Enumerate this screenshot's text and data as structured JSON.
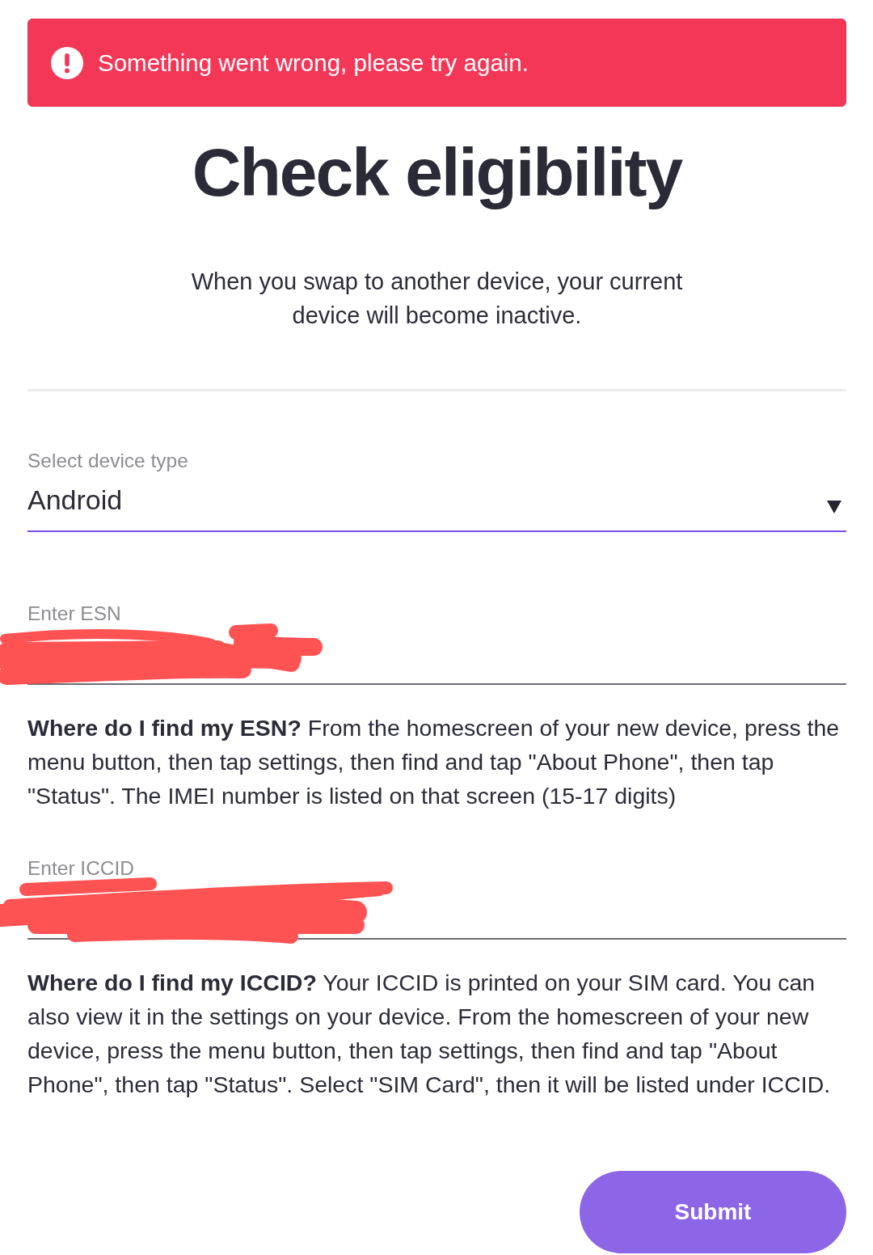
{
  "alert": {
    "kind": "error",
    "message": "Something went wrong, please try again."
  },
  "title": "Check eligibility",
  "subtitle": "When you swap to another device, your current device will become inactive.",
  "form": {
    "device_select": {
      "label": "Select device type",
      "value": "Android",
      "focused": true
    },
    "fields": [
      {
        "label": "Enter ESN",
        "focused": false,
        "redacted": true,
        "help": "**Where do I find my ESN?** From the homescreen of your new device, press the menu button, then tap settings, then find and tap \"About Phone\", then tap \"Status\". The IMEI number is listed on that screen (15-17 digits)"
      },
      {
        "label": "Enter ICCID",
        "focused": false,
        "redacted": true,
        "help": "**Where do I find my ICCID?** Your ICCID is printed on your SIM card. You can also view it in the settings on your device. From the homescreen of your new device, press the menu button, then tap settings, then find and tap \"About Phone\", then tap \"Status\". Select \"SIM Card\", then it will be listed under ICCID."
      }
    ]
  },
  "submit_button": "Submit"
}
